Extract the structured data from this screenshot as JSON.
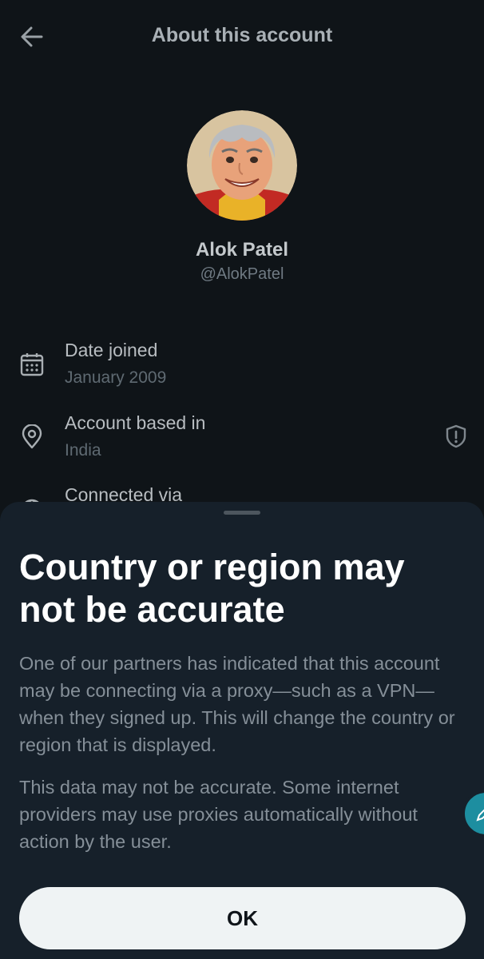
{
  "header": {
    "title": "About this account",
    "back_icon": "arrow-left-icon"
  },
  "profile": {
    "name": "Alok Patel",
    "handle": "@AlokPatel"
  },
  "info": [
    {
      "icon": "calendar-icon",
      "title": "Date joined",
      "value": "January 2009"
    },
    {
      "icon": "location-pin-icon",
      "title": "Account based in",
      "value": "India",
      "badge_icon": "shield-alert-icon"
    },
    {
      "icon": "globe-icon",
      "title": "Connected via"
    }
  ],
  "sheet": {
    "title": "Country or region may not be accurate",
    "paragraph1": "One of our partners has indicated that this account may be connecting via a proxy—such as a VPN—when they signed up. This will change the country or region that is displayed.",
    "paragraph2": "This data may not be accurate. Some internet providers may use proxies automatically without action by the user.",
    "ok_label": "OK"
  },
  "colors": {
    "background": "#0f1418",
    "sheet": "#16202a",
    "button": "#eff3f4",
    "fab": "#1d8ea0"
  }
}
